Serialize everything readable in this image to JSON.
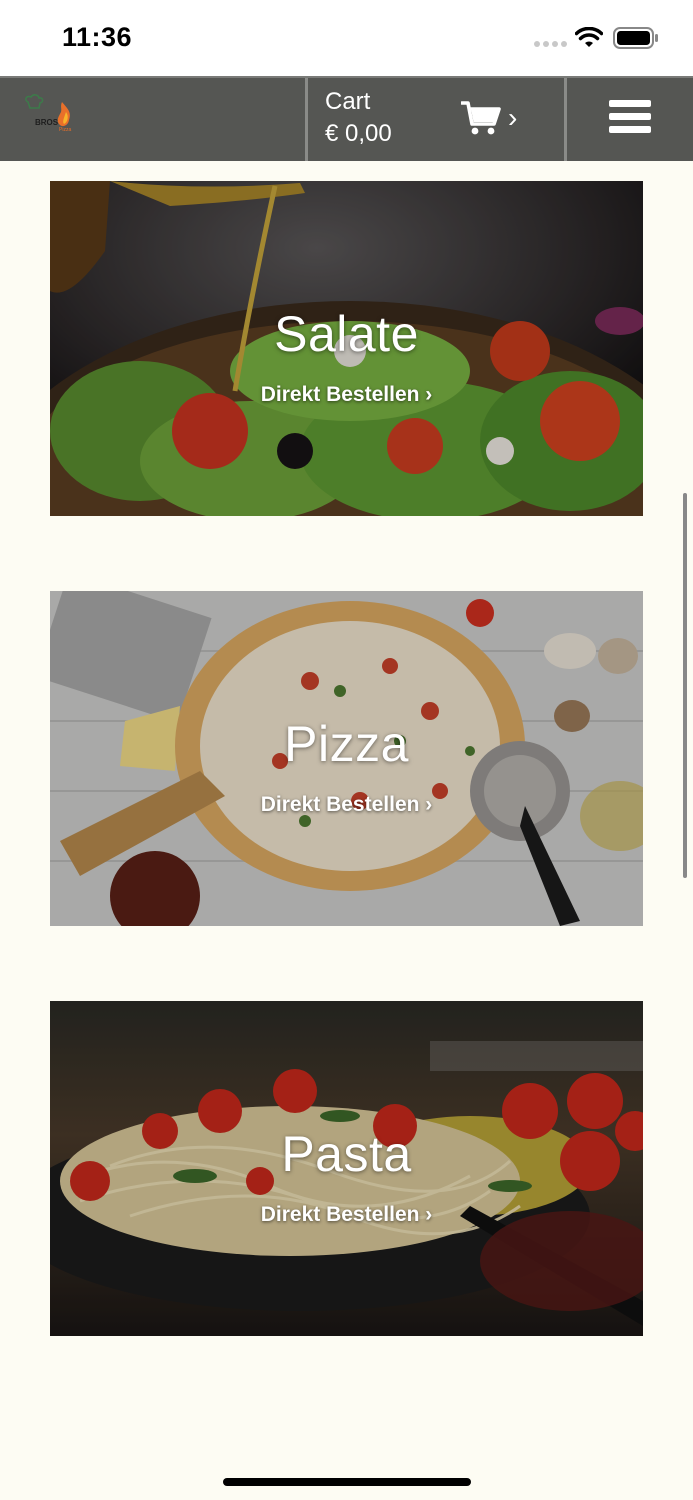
{
  "status_bar": {
    "time": "11:36"
  },
  "header": {
    "logo_text": "BROS",
    "logo_subtext": "Pizza",
    "cart_label": "Cart",
    "cart_total": "€ 0,00",
    "cart_chevron": "›",
    "cart_icon": "shopping-cart-icon",
    "menu_icon": "hamburger-menu-icon"
  },
  "categories": [
    {
      "title": "Salate",
      "link": "Direkt Bestellen ›"
    },
    {
      "title": "Pizza",
      "link": "Direkt Bestellen ›"
    },
    {
      "title": "Pasta",
      "link": "Direkt Bestellen ›"
    }
  ],
  "colors": {
    "page_background": "#fdfcf3",
    "header_background": "#555653",
    "text_on_image": "#ffffff"
  }
}
